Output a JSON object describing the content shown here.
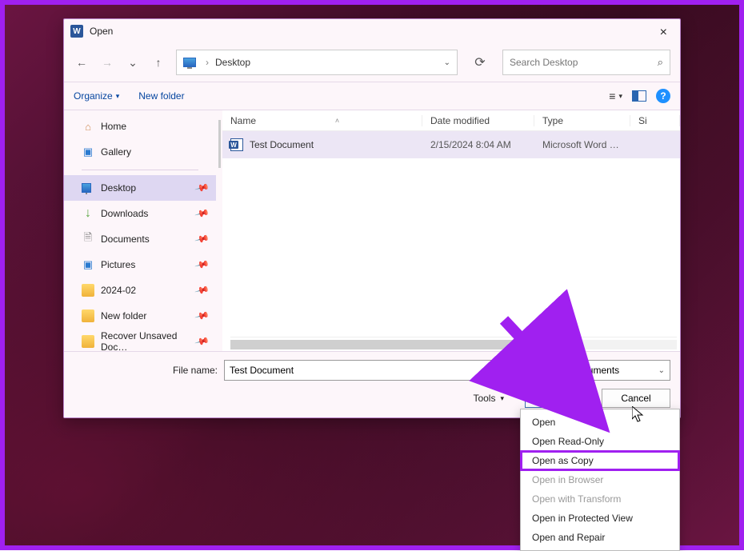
{
  "dialog": {
    "title": "Open",
    "close_label": "×"
  },
  "nav": {
    "back_glyph": "←",
    "forward_glyph": "→",
    "recent_glyph": "⌄",
    "up_glyph": "↑",
    "refresh_glyph": "⟳",
    "address": {
      "sep": "›",
      "location": "Desktop",
      "caret": "⌄"
    },
    "search_placeholder": "Search Desktop",
    "search_icon": "⌕"
  },
  "toolbar": {
    "organize_label": "Organize",
    "organize_caret": "▾",
    "newfolder_label": "New folder",
    "view_lines": "≡",
    "view_caret": "▾",
    "help_label": "?"
  },
  "sidebar": {
    "items": [
      {
        "icon": "home",
        "label": "Home",
        "glyph": "⌂"
      },
      {
        "icon": "gallery",
        "label": "Gallery",
        "glyph": "▣"
      },
      {
        "icon": "desktop",
        "label": "Desktop",
        "selected": true,
        "pinned": true
      },
      {
        "icon": "down",
        "label": "Downloads",
        "glyph": "↓",
        "pinned": true
      },
      {
        "icon": "doc",
        "label": "Documents",
        "glyph": "🗎",
        "pinned": true
      },
      {
        "icon": "pic",
        "label": "Pictures",
        "glyph": "▣",
        "pinned": true
      },
      {
        "icon": "fold",
        "label": "2024-02",
        "pinned": true
      },
      {
        "icon": "fold",
        "label": "New folder",
        "pinned": true
      },
      {
        "icon": "fold",
        "label": "Recover Unsaved Doc…",
        "pinned": true
      }
    ],
    "pin_glyph": "📍"
  },
  "columns": {
    "name": "Name",
    "date": "Date modified",
    "type": "Type",
    "size": "Si",
    "sort_glyph": "˄"
  },
  "files": [
    {
      "name": "Test Document",
      "date": "2/15/2024 8:04 AM",
      "type": "Microsoft Word D..."
    }
  ],
  "footer": {
    "filename_label": "File name:",
    "filename_value": "Test Document",
    "filter_value": "All Word Documents",
    "tools_label": "Tools",
    "tools_caret": "▾",
    "open_label": "Open",
    "open_caret": "▾",
    "cancel_label": "Cancel",
    "dd_caret": "⌄"
  },
  "menu": {
    "items": [
      {
        "label": "Open"
      },
      {
        "label": "Open Read-Only"
      },
      {
        "label": "Open as Copy",
        "highlight": true
      },
      {
        "label": "Open in Browser",
        "disabled": true
      },
      {
        "label": "Open with Transform",
        "disabled": true
      },
      {
        "label": "Open in Protected View"
      },
      {
        "label": "Open and Repair"
      }
    ]
  }
}
